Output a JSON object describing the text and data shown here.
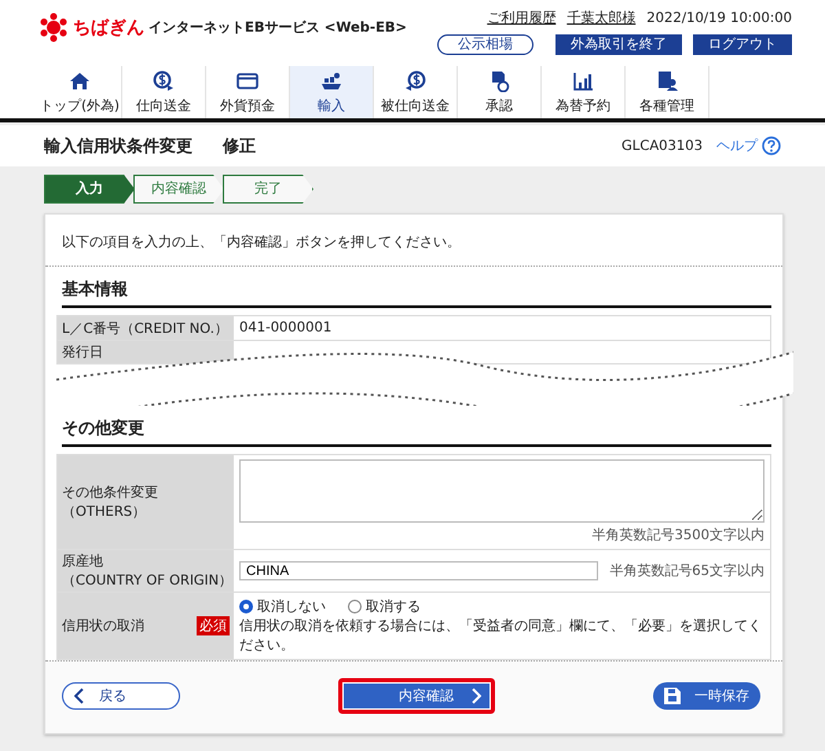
{
  "header": {
    "logo_text": "ちばぎん",
    "service_name": "インターネットEBサービス <Web-EB>",
    "history_link": "ご利用履歴",
    "user_name": "千葉太郎様",
    "datetime": "2022/10/19 10:00:00",
    "buttons": [
      {
        "label": "公示相場",
        "kind": "outline"
      },
      {
        "label": "外為取引を終了",
        "kind": "solid"
      },
      {
        "label": "ログアウト",
        "kind": "solid"
      }
    ]
  },
  "nav": [
    {
      "label": "トップ(外為)",
      "selected": false
    },
    {
      "label": "仕向送金",
      "selected": false
    },
    {
      "label": "外貨預金",
      "selected": false
    },
    {
      "label": "輸入",
      "selected": true
    },
    {
      "label": "被仕向送金",
      "selected": false
    },
    {
      "label": "承認",
      "selected": false
    },
    {
      "label": "為替予約",
      "selected": false
    },
    {
      "label": "各種管理",
      "selected": false
    }
  ],
  "page": {
    "title": "輸入信用状条件変更",
    "mode": "修正",
    "screen_id": "GLCA03103",
    "help": "ヘルプ"
  },
  "steps": [
    {
      "label": "入力",
      "selected": true
    },
    {
      "label": "内容確認",
      "selected": false
    },
    {
      "label": "完了",
      "selected": false
    }
  ],
  "intro": "以下の項目を入力の上、「内容確認」ボタンを押してください。",
  "sections": [
    {
      "title": "基本情報",
      "break_after": true,
      "rows": [
        {
          "kind": "text",
          "label": "L／C番号",
          "label_en": "（CREDIT NO.）",
          "value": "041-0000001"
        },
        {
          "kind": "text",
          "label": "発行日"
        }
      ]
    },
    {
      "title": "その他変更",
      "break_after": false,
      "rows": [
        {
          "kind": "textarea",
          "label": "その他条件変更",
          "label_en": "（OTHERS）",
          "hint": "半角英数記号3500文字以内"
        },
        {
          "kind": "input",
          "label": "原産地",
          "label_en": "（COUNTRY OF ORIGIN）",
          "value": "CHINA",
          "hint": "半角英数記号65文字以内"
        },
        {
          "kind": "radio",
          "label": "信用状の取消",
          "required": "必須",
          "options": [
            {
              "label": "取消しない",
              "selected": true
            },
            {
              "label": "取消する",
              "selected": false
            }
          ],
          "note": "信用状の取消を依頼する場合には、「受益者の同意」欄にて、「必要」を選択してください。"
        }
      ]
    }
  ],
  "footer_buttons": [
    {
      "kind": "back",
      "label": "戻る",
      "highlighted": false
    },
    {
      "kind": "next",
      "label": "内容確認",
      "highlighted": true
    },
    {
      "kind": "save",
      "label": "一時保存",
      "highlighted": false
    }
  ]
}
